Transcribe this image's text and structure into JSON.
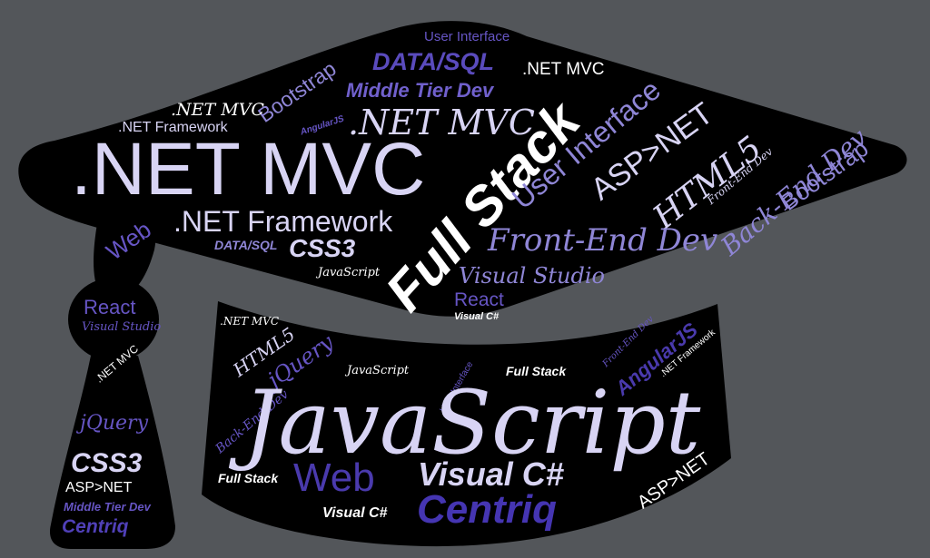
{
  "cloud": {
    "colors": {
      "background": "#53565a",
      "shape": "#000000",
      "white": "#ffffff",
      "lavender": "#d8d4f4",
      "medium_purple": "#8f86d6",
      "purple": "#6655c4",
      "deep_purple": "#4a3aad"
    },
    "words": {
      "user_interface_top": "User Interface",
      "data_sql_top": "DATA/SQL",
      "net_mvc_top_right": ".NET MVC",
      "bootstrap_left": "Bootstrap",
      "middle_tier_top": "Middle Tier Dev",
      "net_mvc_small": ".NET MVC",
      "net_mvc_hand": ".NET MVC",
      "net_framework_small": ".NET Framework",
      "angularjs_small": "AngularJS",
      "net_mvc_large": ".NET MVC",
      "full_stack_large": "Full Stack",
      "user_interface_rot": "User Interface",
      "asp_net_rot": "ASP>NET",
      "html5_top": "HTML5",
      "front_end_small_top": "Front-End Dev",
      "back_end_rot": "Back-End Dev",
      "bootstrap_right": "Bootstrap",
      "net_framework_large": ".NET Framework",
      "web_tassel": "Web",
      "data_sql_small": "DATA/SQL",
      "css3_mid": "CSS3",
      "javascript_tiny": "JavaScript",
      "front_end_mid": "Front-End Dev",
      "visual_studio_mid": "Visual Studio",
      "react_mid": "React",
      "visual_csharp_tiny": "Visual C#",
      "react_tassel": "React",
      "visual_studio_tassel": "Visual Studio",
      "net_mvc_tassel": ".NET MVC",
      "jquery_tassel": "jQuery",
      "css3_tassel": "CSS3",
      "asp_net_tassel": "ASP>NET",
      "middle_tier_tassel": "Middle Tier Dev",
      "centriq_tassel": "Centriq",
      "net_mvc_band": ".NET MVC",
      "html5_band": "HTML5",
      "jquery_band": "jQuery",
      "javascript_band_small": "JavaScript",
      "user_interface_band": "User Interface",
      "full_stack_band": "Full Stack",
      "front_end_band": "Front-End Dev",
      "angularjs_band": "AngularJS",
      "net_framework_band": ".NET Framework",
      "back_end_band": "Back-End Dev",
      "javascript_large": "JavaScript",
      "full_stack_band_low": "Full Stack",
      "web_band": "Web",
      "visual_csharp_band": "Visual C#",
      "asp_net_band": "ASP>NET",
      "visual_csharp_small": "Visual C#",
      "centriq_band": "Centriq"
    }
  }
}
